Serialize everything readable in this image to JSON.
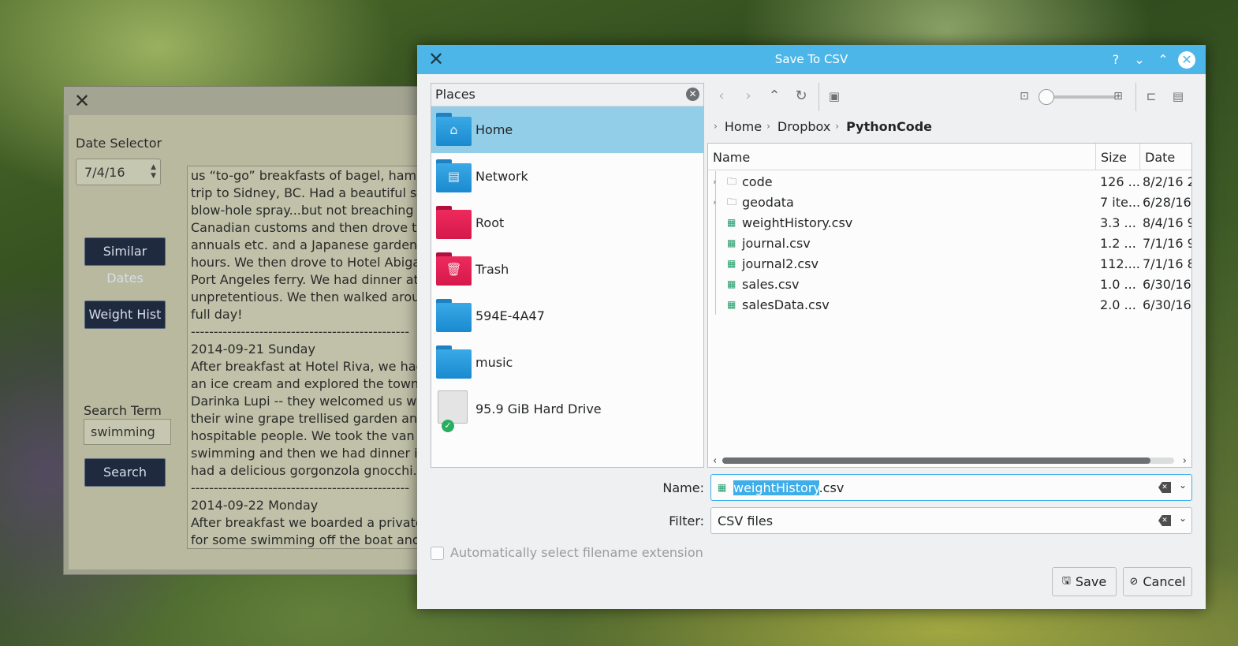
{
  "bg_app": {
    "date_selector_label": "Date Selector",
    "date_value": "7/4/16",
    "similar_dates_button": "Similar Dates",
    "weight_hist_button": "Weight Hist",
    "search_term_label": "Search Term",
    "search_value": "swimming",
    "search_button": "Search",
    "journal_lines": [
      "us “to-go” breakfasts of bagel, ham, eg",
      "trip to Sidney, BC. Had a beautiful sail t",
      "blow-hole spray...but not breaching or",
      "Canadian customs and then drove to B",
      "annuals etc. and a Japanese garden. W",
      "hours. We then drove to Hotel Abigail i",
      "Port Angeles ferry. We had dinner at a",
      "unpretentious. We then walked aroun",
      "full day!",
      "------------------------------------------------",
      "2014-09-21 Sunday",
      "After breakfast at Hotel Riva, we had a",
      "an ice cream and explored the towns a",
      "Darinka Lupi -- they welcomed us with",
      "their wine grape trellised garden and g",
      "hospitable people. We took the van ba",
      "swimming and then we had dinner in H",
      "had a delicious gorgonzola gnocchi.",
      "------------------------------------------------",
      "2014-09-22 Monday",
      "After breakfast we boarded a private b",
      "for some swimming off the boat and a"
    ]
  },
  "dialog": {
    "title": "Save To CSV",
    "places_header": "Places",
    "places": [
      {
        "label": "Home",
        "icon": "home-icon",
        "color": "blue",
        "selected": true
      },
      {
        "label": "Network",
        "icon": "network-icon",
        "color": "blue",
        "selected": false
      },
      {
        "label": "Root",
        "icon": "folder-icon",
        "color": "red",
        "selected": false
      },
      {
        "label": "Trash",
        "icon": "trash-icon",
        "color": "red",
        "selected": false
      },
      {
        "label": "594E-4A47",
        "icon": "folder-icon",
        "color": "blue",
        "selected": false
      },
      {
        "label": "music",
        "icon": "folder-icon",
        "color": "blue",
        "selected": false
      },
      {
        "label": "95.9 GiB Hard Drive",
        "icon": "hard-drive-icon",
        "color": "drive",
        "selected": false
      }
    ],
    "breadcrumb": [
      "Home",
      "Dropbox",
      "PythonCode"
    ],
    "columns": {
      "name": "Name",
      "size": "Size",
      "date": "Date"
    },
    "files": [
      {
        "name": "code",
        "size": "126 ...",
        "date": "8/2/16 2",
        "type": "folder"
      },
      {
        "name": "geodata",
        "size": "7 ite...",
        "date": "6/28/16",
        "type": "folder"
      },
      {
        "name": "weightHistory.csv",
        "size": "3.3 ...",
        "date": "8/4/16 9",
        "type": "csv"
      },
      {
        "name": "journal.csv",
        "size": "1.2 ...",
        "date": "7/1/16 9",
        "type": "csv"
      },
      {
        "name": "journal2.csv",
        "size": "112....",
        "date": "7/1/16 8",
        "type": "csv"
      },
      {
        "name": "sales.csv",
        "size": "1.0 ...",
        "date": "6/30/16",
        "type": "csv"
      },
      {
        "name": "salesData.csv",
        "size": "2.0 ...",
        "date": "6/30/16",
        "type": "csv"
      }
    ],
    "name_label": "Name:",
    "name_selected": "weightHistory",
    "name_rest": ".csv",
    "filter_label": "Filter:",
    "filter_value": "CSV files",
    "auto_ext_label": "Automatically select filename extension",
    "save_label": "Save",
    "cancel_label": "Cancel"
  },
  "colors": {
    "accent": "#3daee9",
    "titlebar": "#4db6e8",
    "selected_place": "#93cee9"
  }
}
